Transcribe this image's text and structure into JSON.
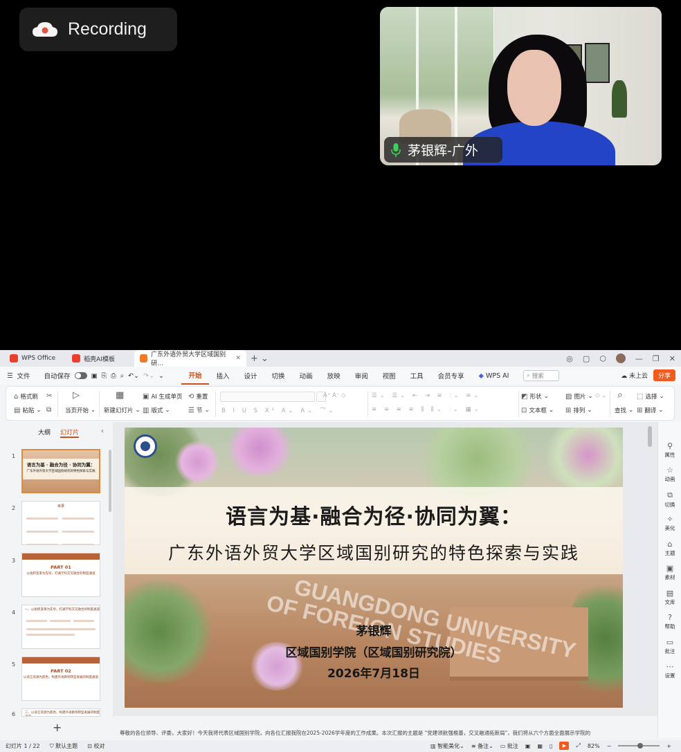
{
  "overlay": {
    "recording_label": "Recording",
    "participant_name": "茅银辉-广外"
  },
  "tabs": [
    {
      "label": "WPS Office",
      "color": "#e8402a"
    },
    {
      "label": "稻壳AI模板",
      "color": "#e8402a"
    },
    {
      "label": "广东外语外贸大学区域国别研…",
      "color": "#f07a2a"
    }
  ],
  "window_controls": [
    "—",
    "❐",
    "✕"
  ],
  "menubar": {
    "file": "文件",
    "autosave": "自动保存",
    "items": [
      "开始",
      "插入",
      "设计",
      "切换",
      "动画",
      "放映",
      "审阅",
      "视图",
      "工具",
      "会员专享",
      "WPS AI"
    ],
    "active": "开始",
    "search_placeholder": "搜索",
    "cloud": "未上云",
    "share": "分享"
  },
  "ribbon": {
    "format_painter": "格式刷",
    "paste": "粘贴",
    "from_current": "当页开始",
    "new_slide": "新建幻灯片",
    "ai_gen": "AI 生成单页",
    "layout": "版式",
    "reset": "重置",
    "section": "节",
    "shape": "形状",
    "picture": "图片",
    "textbox": "文本框",
    "arrange": "排列",
    "find": "查找",
    "select": "选择",
    "translate": "翻译"
  },
  "left_panel": {
    "tab_outline": "大纲",
    "tab_slides": "幻灯片",
    "thumbs": [
      {
        "num": "1",
        "title": "语言为基 · 融合为径 · 协同为翼：",
        "sub": "广东外语外贸大学区域国别研究的特色探索与实践"
      },
      {
        "num": "2",
        "title": "目录",
        "sub": ""
      },
      {
        "num": "3",
        "title": "PART 01",
        "sub": "以组织变革为先导，打通学科交叉融合的制度通道"
      },
      {
        "num": "4",
        "title": "",
        "sub": "一、以组织变革为先导，打通学科交叉融合的制度通道"
      },
      {
        "num": "5",
        "title": "PART 02",
        "sub": "以语言资源为底色，构建外语教师转型发展的制度通道"
      },
      {
        "num": "6",
        "title": "",
        "sub": "二、以语言资源为底色，构建外语教师转型发展的制度通道"
      }
    ]
  },
  "slide": {
    "title": "语言为基·融合为径·协同为翼：",
    "subtitle": "广东外语外贸大学区域国别研究的特色探索与实践",
    "author": "茅银辉",
    "institute": "区域国别学院（区域国别研究院）",
    "date": "2026年7月18日",
    "wall_text_1": "GUANGDONG UNIVERSITY",
    "wall_text_2": "OF FOREIGN STUDIES"
  },
  "right_bar": [
    "属性",
    "动画",
    "切换",
    "美化",
    "主题",
    "素材",
    "文库",
    "帮助",
    "批注",
    "设置"
  ],
  "notes": "尊敬的各位领导、评委，大家好！今天我将代表区域国别学院，向各位汇报我院在2025-2026学年度的工作成果。本次汇报的主题是 \"党建领航强根基，交叉融通拓新局\"，我们将从六个方面全面展示学院的",
  "status": {
    "slide_count": "幻灯片 1 / 22",
    "theme": "默认主题",
    "proof": "校对",
    "beautify": "智能美化",
    "remarks": "备注",
    "comments": "批注",
    "zoom": "82%"
  }
}
